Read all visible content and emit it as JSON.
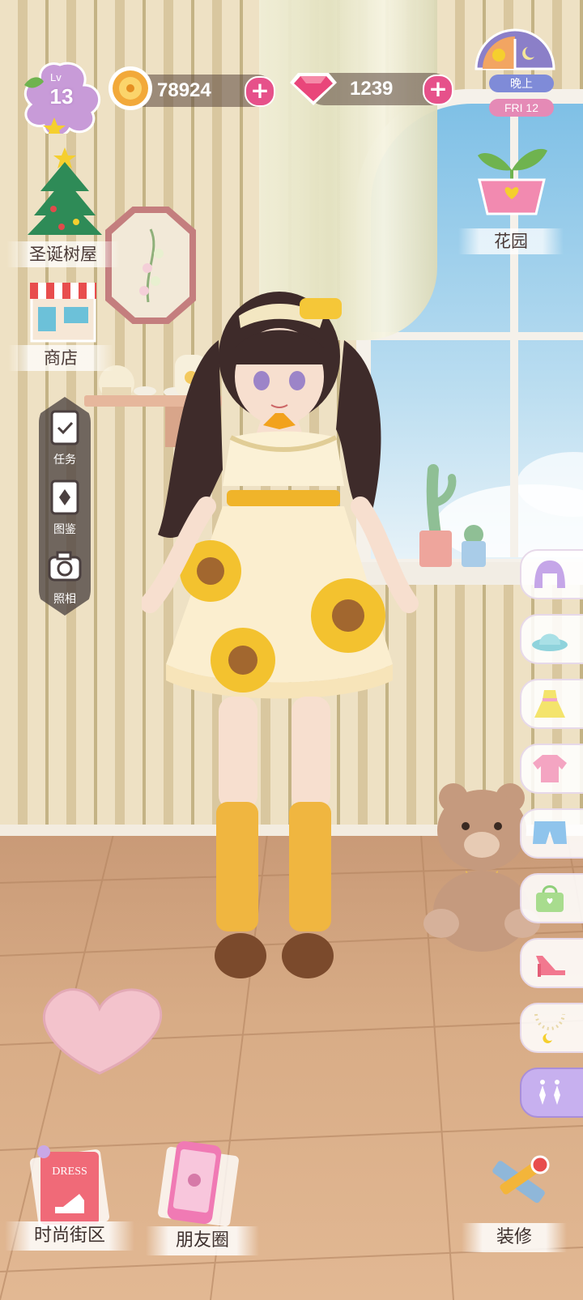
{
  "hud": {
    "level_prefix": "Lv",
    "level": "13",
    "gold": "78924",
    "gems": "1239",
    "time_of_day": "晚上",
    "date": "FRI 12"
  },
  "left_menu": {
    "christmas_house": "圣诞树屋",
    "shop": "商店"
  },
  "right_menu": {
    "garden": "花园"
  },
  "side_panel": {
    "tasks": "任务",
    "catalog": "图鉴",
    "photo": "照相"
  },
  "categories": [
    "hair",
    "hat",
    "dress",
    "top",
    "bottom",
    "bag",
    "shoes",
    "necklace",
    "earrings"
  ],
  "active_category": "earrings",
  "bottom": {
    "fashion_street": "时尚街区",
    "friends": "朋友圈",
    "decorate": "装修",
    "dress_card_text": "DRESS"
  },
  "colors": {
    "plus_pink": "#e6518a",
    "accent_purple": "#c7b0ef"
  }
}
